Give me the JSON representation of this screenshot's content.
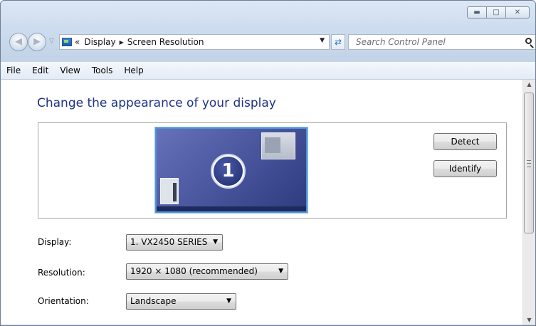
{
  "window": {
    "caption_buttons": {
      "minimize_icon": "minimize-icon",
      "maximize_icon": "maximize-icon",
      "close_icon": "close-icon"
    }
  },
  "nav": {
    "back_icon": "back-arrow-icon",
    "forward_icon": "forward-arrow-icon",
    "breadcrumb_overflow": "«",
    "breadcrumbs": [
      "Display",
      "Screen Resolution"
    ],
    "search_placeholder": "Search Control Panel"
  },
  "menu": [
    "File",
    "Edit",
    "View",
    "Tools",
    "Help"
  ],
  "main": {
    "title": "Change the appearance of your display",
    "monitor_number": "1",
    "detect_label": "Detect",
    "identify_label": "Identify",
    "fields": [
      {
        "label": "Display:",
        "value": "1. VX2450 SERIES"
      },
      {
        "label": "Resolution:",
        "value": "1920 × 1080 (recommended)"
      },
      {
        "label": "Orientation:",
        "value": "Landscape"
      }
    ]
  },
  "colors": {
    "title": "#1e3287",
    "monitor": "#4c58a0",
    "monitor_border": "#4f93d6"
  }
}
